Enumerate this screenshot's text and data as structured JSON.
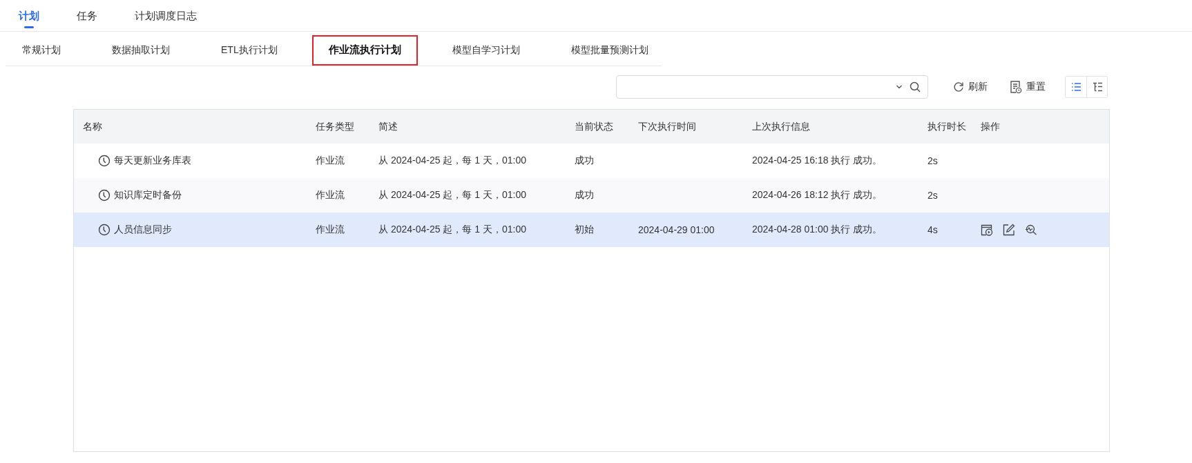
{
  "top_tabs": [
    {
      "label": "计划",
      "selected": true
    },
    {
      "label": "任务",
      "selected": false
    },
    {
      "label": "计划调度日志",
      "selected": false
    }
  ],
  "sub_tabs": [
    {
      "label": "常规计划",
      "selected": false
    },
    {
      "label": "数据抽取计划",
      "selected": false
    },
    {
      "label": "ETL执行计划",
      "selected": false
    },
    {
      "label": "作业流执行计划",
      "selected": true
    },
    {
      "label": "模型自学习计划",
      "selected": false
    },
    {
      "label": "模型批量预测计划",
      "selected": false
    }
  ],
  "toolbar": {
    "refresh": "刷新",
    "reset": "重置",
    "view_modes": [
      {
        "kind": "list",
        "selected": true
      },
      {
        "kind": "tree",
        "selected": false
      }
    ]
  },
  "table": {
    "columns": [
      "名称",
      "任务类型",
      "简述",
      "当前状态",
      "下次执行时间",
      "上次执行信息",
      "执行时长",
      "操作"
    ],
    "rows": [
      {
        "name": "每天更新业务库表",
        "type": "作业流",
        "summary": "从 2024-04-25 起，每 1 天，01:00",
        "status": "成功",
        "next_run": "",
        "last_run": "2024-04-25 16:18 执行 成功。",
        "duration": "2s",
        "selected": false
      },
      {
        "name": "知识库定时备份",
        "type": "作业流",
        "summary": "从 2024-04-25 起，每 1 天，01:00",
        "status": "成功",
        "next_run": "",
        "last_run": "2024-04-26 18:12 执行 成功。",
        "duration": "2s",
        "selected": false
      },
      {
        "name": "人员信息同步",
        "type": "作业流",
        "summary": "从 2024-04-25 起，每 1 天，01:00",
        "status": "初始",
        "next_run": "2024-04-29 01:00",
        "last_run": "2024-04-28 01:00 执行 成功。",
        "duration": "4s",
        "selected": true,
        "actions": [
          {
            "kind": "run"
          },
          {
            "kind": "edit"
          },
          {
            "kind": "inspect"
          }
        ]
      }
    ]
  }
}
